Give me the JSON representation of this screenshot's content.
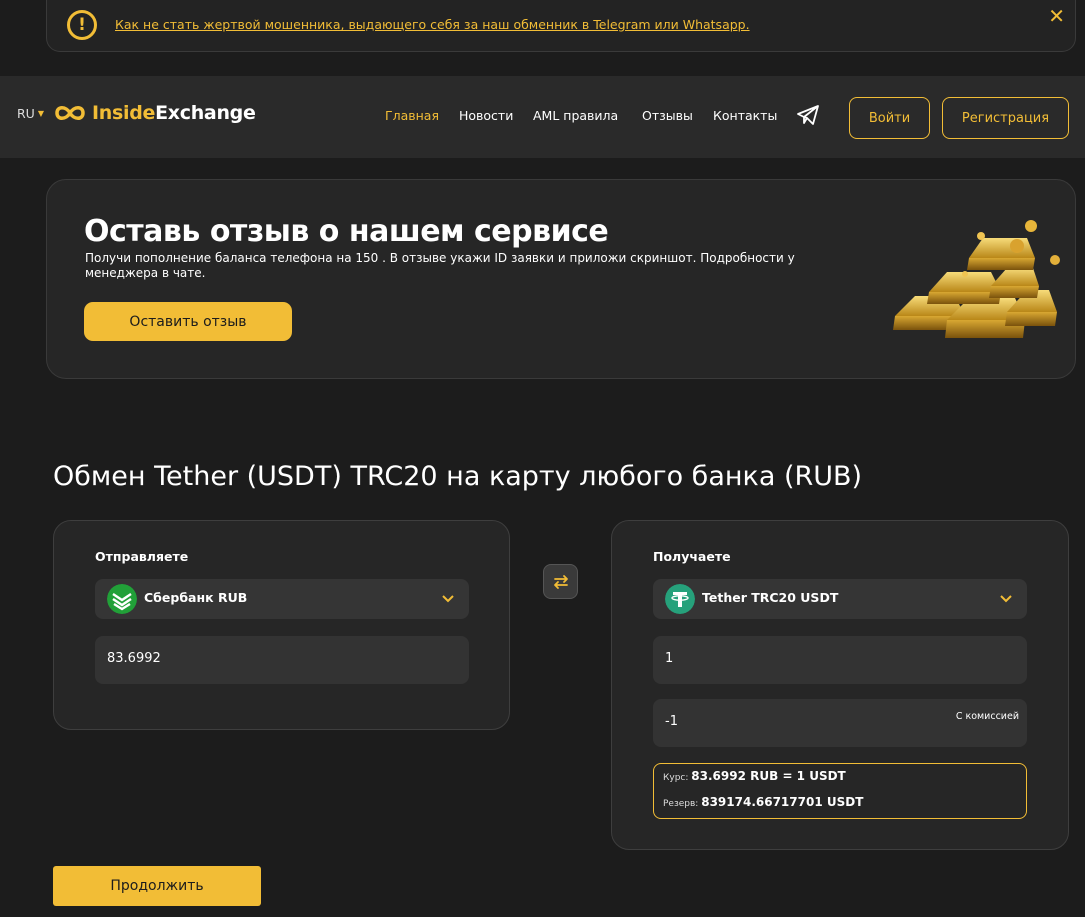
{
  "alert": {
    "icon": "exclamation-icon",
    "link": "Как не стать жертвой мошенника, выдающего себя за наш обменник в Telegram или Whatsapp.",
    "close": "✕"
  },
  "header": {
    "lang": "RU",
    "logo": {
      "part1": "Inside",
      "part2": "Exchange"
    },
    "nav": [
      "Главная",
      "Новости",
      "AML правила",
      "Отзывы",
      "Контакты"
    ],
    "login": "Войти",
    "register": "Регистрация"
  },
  "promo": {
    "title": "Оставь отзыв о нашем сервисе",
    "text": "Получи пополнение баланса телефона на 150  . В отзыве укажи ID заявки и приложи скриншот. Подробности у менеджера в чате.",
    "button": "Оставить отзыв"
  },
  "exchange": {
    "title": "Обмен Tether (USDT) TRC20 на карту любого банка (RUB)",
    "send": {
      "label": "Отправляете",
      "currency": "Сбербанк RUB",
      "amount": "83.6992"
    },
    "receive": {
      "label": "Получаете",
      "currency": "Tether TRC20 USDT",
      "amount": "1",
      "amount_with_fee": "-1",
      "fee_note": "С комиссией"
    },
    "rate_label": "Курс:",
    "rate": "83.6992 RUB = 1 USDT",
    "reserve_label": "Резерв:",
    "reserve": "839174.66717701 USDT",
    "continue": "Продолжить"
  },
  "colors": {
    "accent": "#f2bd36",
    "background": "#1c1c1c",
    "panel": "#262626",
    "sber": "#21a038",
    "tether": "#26a17b"
  }
}
